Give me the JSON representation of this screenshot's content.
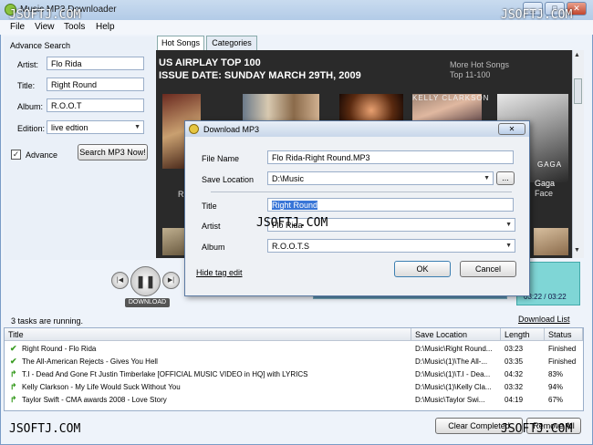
{
  "window": {
    "title": "Music MP3 Downloader",
    "minimize": "_",
    "maximize": "□",
    "close": "✕"
  },
  "menu": [
    "File",
    "View",
    "Tools",
    "Help"
  ],
  "watermarks": {
    "tl": "JSOFTJ.COM",
    "tr": "JSOFTJ.COM",
    "mid": "JSOFTJ.COM",
    "bl": "JSOFTJ.COM",
    "br": "JSOFTJ.COM"
  },
  "search": {
    "group_label": "Advance Search",
    "artist_label": "Artist:",
    "artist_value": "Flo Rida",
    "title_label": "Title:",
    "title_value": "Right Round",
    "album_label": "Album:",
    "album_value": "R.O.O.T",
    "edition_label": "Edition:",
    "edition_value": "live edtion",
    "advance_label": "Advance",
    "advance_checked": true,
    "search_button": "Search MP3 Now!"
  },
  "tabs": [
    {
      "label": "Hot Songs",
      "active": true
    },
    {
      "label": "Categories",
      "active": false
    }
  ],
  "web": {
    "title_line1": "US AIRPLAY TOP 100",
    "title_line2": "ISSUE DATE: SUNDAY MARCH 29TH, 2009",
    "more_line1": "More Hot Songs",
    "more_line2": "Top 11-100",
    "card_text": "KELLY CLARKSON",
    "gaga_text": "GAGA",
    "gaga_name": "Gaga",
    "gaga_song": "Face",
    "partial_left": "Ri"
  },
  "player": {
    "download_label": "DOWNLOAD",
    "time": "03:22 / 03:22",
    "progress": 1.0
  },
  "status": {
    "tasks_text": "3 tasks are running.",
    "download_list_link": "Download List"
  },
  "table": {
    "headers": [
      "Title",
      "Save Location",
      "Length",
      "Status"
    ],
    "rows": [
      {
        "icon": "check",
        "title": "Right Round - Flo Rida",
        "location": "D:\\Music\\Right Round...",
        "length": "03:23",
        "status": "Finished"
      },
      {
        "icon": "check",
        "title": "The All-American Rejects - Gives You Hell",
        "location": "D:\\Music\\(1)\\The All-...",
        "length": "03:35",
        "status": "Finished"
      },
      {
        "icon": "arrow",
        "title": "T.I - Dead And Gone Ft Justin Timberlake [OFFICIAL MUSIC VIDEO in HQ] with LYRICS",
        "location": "D:\\Music\\(1)\\T.I - Dea...",
        "length": "04:32",
        "status": "83%"
      },
      {
        "icon": "arrow",
        "title": "Kelly Clarkson - My Life Would Suck Without You",
        "location": "D:\\Music\\(1)\\Kelly Cla...",
        "length": "03:32",
        "status": "94%"
      },
      {
        "icon": "arrow",
        "title": "Taylor Swift - CMA awards 2008 - Love Story",
        "location": "D:\\Music\\Taylor Swi...",
        "length": "04:19",
        "status": "67%"
      }
    ]
  },
  "bottom": {
    "clear_completed": "Clear Completed",
    "remove_all": "Remove All"
  },
  "dialog": {
    "title": "Download MP3",
    "close": "✕",
    "file_name_label": "File Name",
    "file_name_value": "Flo Rida-Right Round.MP3",
    "save_location_label": "Save Location",
    "save_location_value": "D:\\Music",
    "browse": "...",
    "title_label": "Title",
    "title_value": "Right Round",
    "artist_label": "Artist",
    "artist_value": "Flo Rida",
    "album_label": "Album",
    "album_value": "R.O.O.T.S",
    "hide_tag_edit": "Hide tag edit",
    "ok": "OK",
    "cancel": "Cancel"
  }
}
